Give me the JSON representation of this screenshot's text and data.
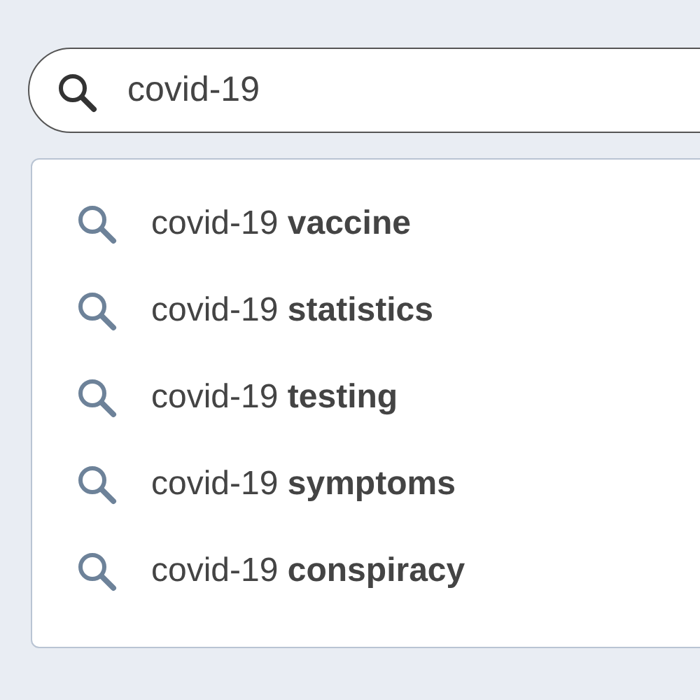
{
  "search": {
    "value": "covid-19"
  },
  "suggestions": [
    {
      "text": "covid-19 **vaccine**"
    },
    {
      "text": "covid-19 **statistics**"
    },
    {
      "text": "covid-19 **testing**"
    },
    {
      "text": "covid-19 **symptoms**"
    },
    {
      "text": "covid-19 **conspiracy**"
    }
  ]
}
